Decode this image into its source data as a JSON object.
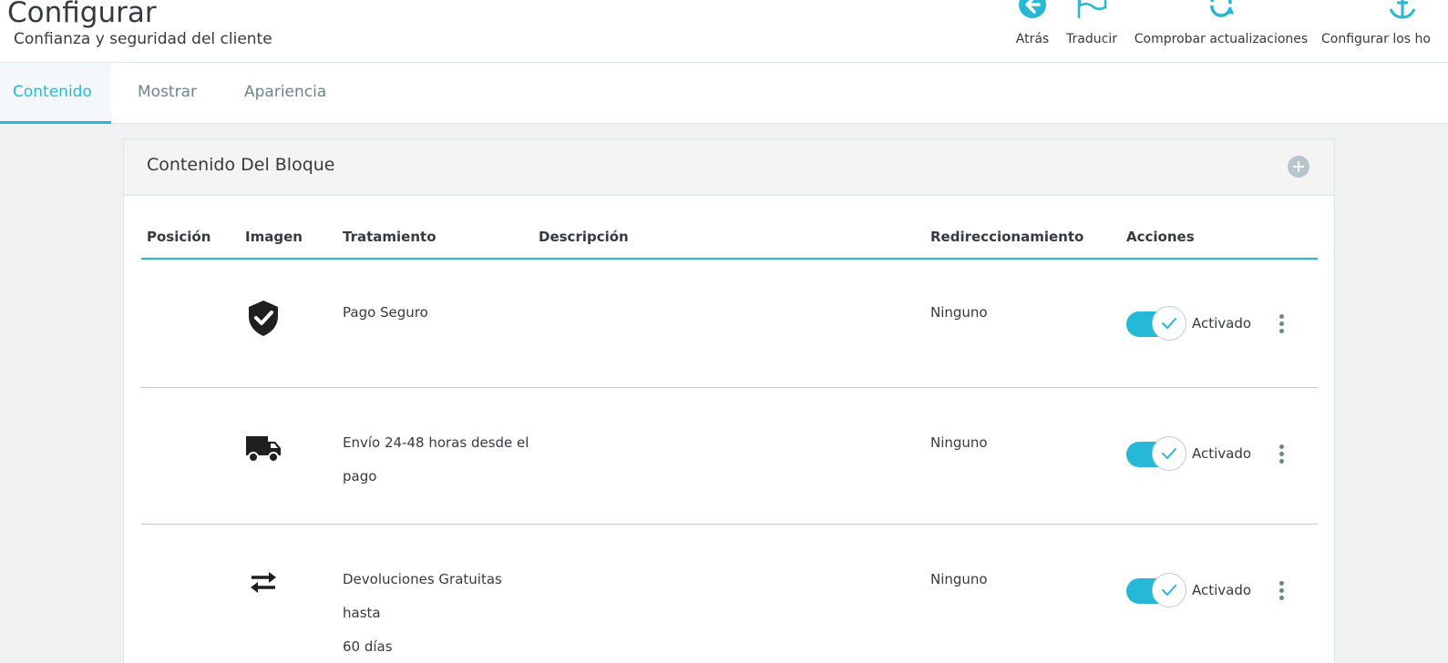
{
  "header": {
    "title": "Configurar",
    "subtitle": "Confianza y seguridad del cliente",
    "toolbar": [
      {
        "label": "Atrás",
        "icon": "back-arrow-icon"
      },
      {
        "label": "Traducir",
        "icon": "flag-icon"
      },
      {
        "label": "Comprobar actualizaciones",
        "icon": "refresh-icon"
      },
      {
        "label": "Configurar los ho",
        "icon": "anchor-icon"
      }
    ]
  },
  "tabs": [
    {
      "label": "Contenido",
      "active": true
    },
    {
      "label": "Mostrar",
      "active": false
    },
    {
      "label": "Apariencia",
      "active": false
    }
  ],
  "panel": {
    "title": "Contenido Del Bloque",
    "add_icon": "plus-circle-icon",
    "columns": [
      "Posición",
      "Imagen",
      "Tratamiento",
      "Descripción",
      "Redireccionamiento",
      "Acciones"
    ],
    "rows": [
      {
        "icon": "shield-check-icon",
        "treatment": [
          "Pago Seguro"
        ],
        "description": "",
        "redirect": "Ninguno",
        "enabled": true,
        "status": "Activado"
      },
      {
        "icon": "truck-icon",
        "treatment": [
          "Envío 24-48 horas desde el",
          "pago"
        ],
        "description": "",
        "redirect": "Ninguno",
        "enabled": true,
        "status": "Activado"
      },
      {
        "icon": "exchange-arrows-icon",
        "treatment": [
          "Devoluciones Gratuitas hasta",
          "60 días"
        ],
        "description": "",
        "redirect": "Ninguno",
        "enabled": true,
        "status": "Activado"
      }
    ]
  },
  "colors": {
    "accent": "#25b9d7",
    "text": "#363a41",
    "muted": "#6c868e",
    "background": "#eff1f2"
  }
}
